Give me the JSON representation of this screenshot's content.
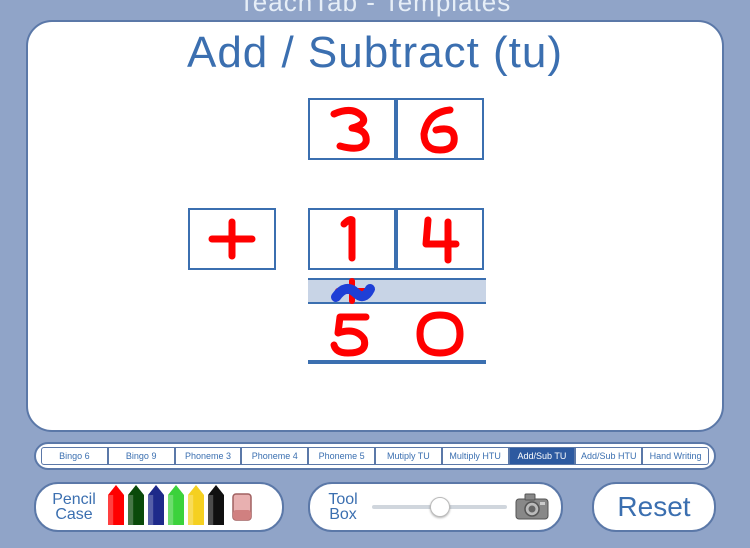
{
  "app_title": "TeachTab - Templates",
  "worksheet_title": "Add / Subtract (tu)",
  "problem": {
    "top_tens": "3",
    "top_units": "6",
    "operator": "+",
    "mid_tens": "1",
    "mid_units": "4",
    "carry_tens": "+",
    "carry_units": "",
    "ans_tens": "5",
    "ans_units": "0"
  },
  "tabs": [
    {
      "label": "Bingo 6",
      "active": false
    },
    {
      "label": "Bingo 9",
      "active": false
    },
    {
      "label": "Phoneme 3",
      "active": false
    },
    {
      "label": "Phoneme 4",
      "active": false
    },
    {
      "label": "Phoneme 5",
      "active": false
    },
    {
      "label": "Mutiply TU",
      "active": false
    },
    {
      "label": "Multiply HTU",
      "active": false
    },
    {
      "label": "Add/Sub TU",
      "active": true
    },
    {
      "label": "Add/Sub HTU",
      "active": false
    },
    {
      "label": "Hand Writing",
      "active": false
    }
  ],
  "pencil_case": {
    "label": "Pencil Case",
    "colors": [
      "#ff0000",
      "#0a4a0a",
      "#1e2a8a",
      "#3cd23c",
      "#f5d020",
      "#101010"
    ]
  },
  "tool_box": {
    "label": "Tool Box",
    "slider_value": 0.5
  },
  "reset_label": "Reset"
}
